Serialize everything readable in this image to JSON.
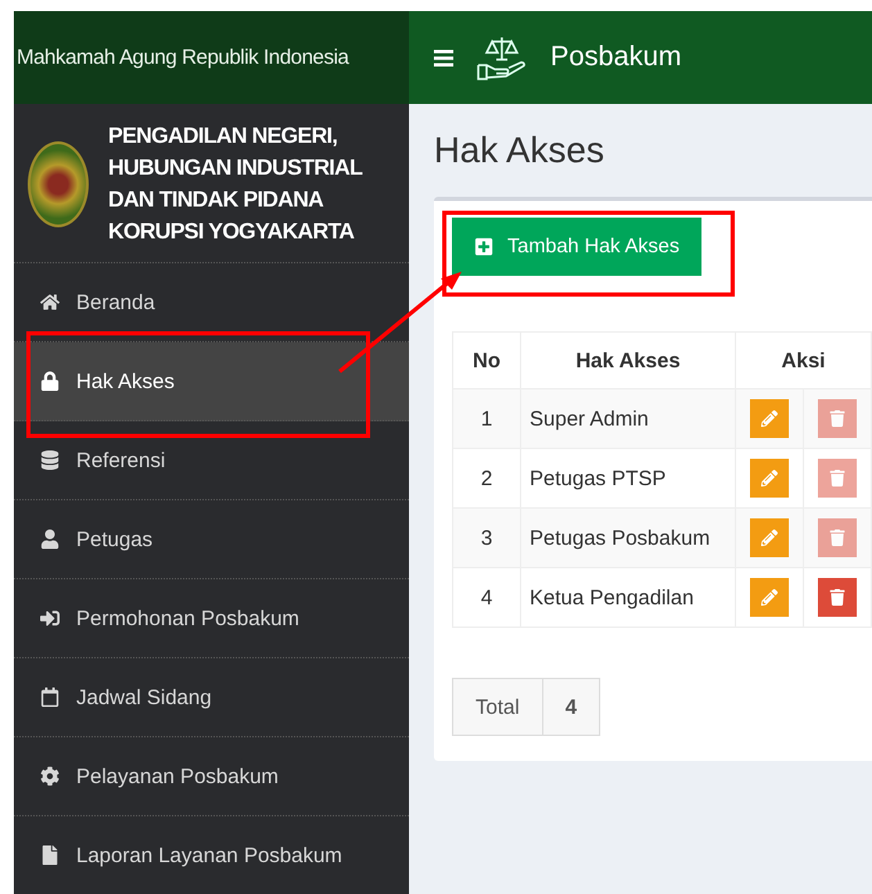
{
  "sidebar": {
    "brand": "Mahkamah Agung Republik Indonesia",
    "court_name": "PENGADILAN NEGERI, HUBUNGAN INDUSTRIAL DAN TINDAK PIDANA KORUPSI YOGYAKARTA",
    "items": [
      {
        "label": "Beranda",
        "selected": false
      },
      {
        "label": "Hak Akses",
        "selected": true
      },
      {
        "label": "Referensi",
        "selected": false
      },
      {
        "label": "Petugas",
        "selected": false
      },
      {
        "label": "Permohonan Posbakum",
        "selected": false
      },
      {
        "label": "Jadwal Sidang",
        "selected": false
      },
      {
        "label": "Pelayanan Posbakum",
        "selected": false
      },
      {
        "label": "Laporan Layanan Posbakum",
        "selected": false
      }
    ]
  },
  "topbar": {
    "title": "Posbakum"
  },
  "page": {
    "heading": "Hak Akses",
    "add_button": "Tambah Hak Akses",
    "table": {
      "columns": [
        "No",
        "Hak Akses",
        "Aksi"
      ],
      "rows": [
        {
          "no": "1",
          "name": "Super Admin",
          "delete_disabled": true
        },
        {
          "no": "2",
          "name": "Petugas PTSP",
          "delete_disabled": true
        },
        {
          "no": "3",
          "name": "Petugas Posbakum",
          "delete_disabled": true
        },
        {
          "no": "4",
          "name": "Ketua Pengadilan",
          "delete_disabled": false
        }
      ]
    },
    "total": {
      "label": "Total",
      "value": "4"
    }
  }
}
